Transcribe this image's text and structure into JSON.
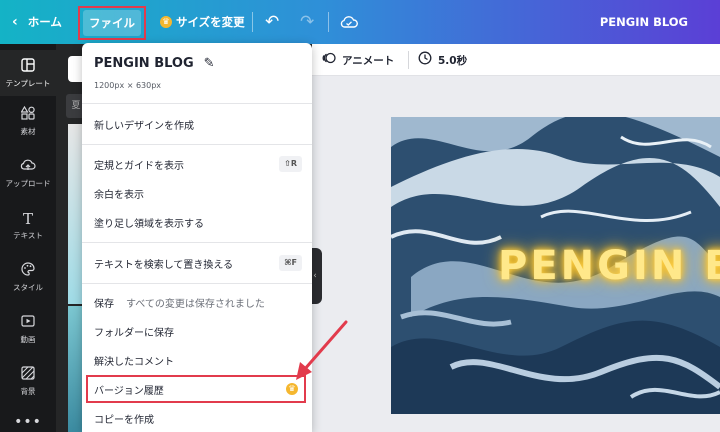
{
  "topbar": {
    "home_label": "ホーム",
    "file_label": "ファイル",
    "resize_label": "サイズを変更",
    "blog_title": "PENGIN BLOG"
  },
  "sidebar": {
    "items": [
      {
        "label": "テンプレート",
        "icon": "template-icon"
      },
      {
        "label": "素材",
        "icon": "elements-icon"
      },
      {
        "label": "アップロード",
        "icon": "upload-icon"
      },
      {
        "label": "テキスト",
        "icon": "text-icon"
      },
      {
        "label": "スタイル",
        "icon": "palette-icon"
      },
      {
        "label": "動画",
        "icon": "video-icon"
      },
      {
        "label": "背景",
        "icon": "background-icon"
      }
    ]
  },
  "panel": {
    "chip": "夏"
  },
  "editor_toolbar": {
    "animate_label": "アニメート",
    "duration_label": "5.0秒"
  },
  "design": {
    "text": "PENGIN B"
  },
  "menu": {
    "title": "PENGIN BLOG",
    "dimensions": "1200px × 630px",
    "items": {
      "new_design": "新しいデザインを作成",
      "show_rulers": "定規とガイドを表示",
      "show_rulers_shortcut": "⇧R",
      "show_margins": "余白を表示",
      "show_bleed": "塗り足し領域を表示する",
      "find_replace": "テキストを検索して置き換える",
      "find_replace_shortcut": "⌘F",
      "save": "保存",
      "save_status": "すべての変更は保存されました",
      "save_to_folder": "フォルダーに保存",
      "resolved_comments": "解決したコメント",
      "version_history": "バージョン履歴",
      "make_copy": "コピーを作成"
    }
  },
  "colors": {
    "highlight": "#e23b4c",
    "crown": "#f5b72f",
    "sidebar_bg": "#18191b"
  }
}
